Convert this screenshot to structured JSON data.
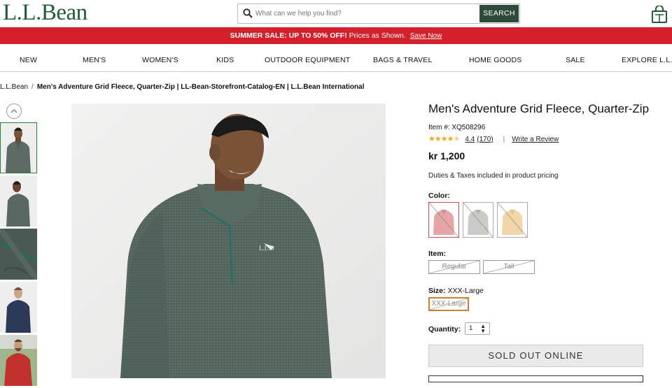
{
  "header": {
    "logo": "L.L.Bean",
    "search_placeholder": "What can we help you find?",
    "search_button": "SEARCH"
  },
  "promo": {
    "bold": "SUMMER SALE: UP TO 50% OFF!",
    "text": " Prices as Shown.",
    "link": "Save Now"
  },
  "nav": [
    "NEW",
    "MEN'S",
    "WOMEN'S",
    "KIDS",
    "OUTDOOR EQUIPMENT",
    "BAGS & TRAVEL",
    "HOME GOODS",
    "SALE",
    "EXPLORE L.L.B"
  ],
  "breadcrumb": {
    "home": "L.L.Bean",
    "separator": "/",
    "current": "Men's Adventure Grid Fleece, Quarter-Zip | LL-Bean-Storefront-Catalog-EN | L.L.Bean International"
  },
  "product": {
    "title": "Men's Adventure Grid Fleece, Quarter-Zip",
    "item_number": "Item #: XQ508296",
    "rating": 4.4,
    "rating_text": "4.4",
    "review_count": "(170)",
    "rating_divider": "|",
    "write_review": "Write a Review",
    "price": "kr 1,200",
    "duties": "Duties & Taxes included in product pricing"
  },
  "options": {
    "color_label": "Color:",
    "colors": [
      "#e6a5a7",
      "#c9cbc6",
      "#f1d7a8"
    ],
    "item_label": "Item:",
    "items": [
      "Regular",
      "Tall"
    ],
    "size_label": "Size:",
    "size_value": "XXX-Large",
    "sizes": [
      "XXX-Large"
    ],
    "quantity_label": "Quantity:",
    "quantity": "1"
  },
  "actions": {
    "sold_out": "SOLD OUT ONLINE"
  },
  "colors": {
    "brand_green": "#1f5c37",
    "promo_red": "#d5202b",
    "search_button": "#2e4a3b",
    "star": "#f5a623"
  }
}
